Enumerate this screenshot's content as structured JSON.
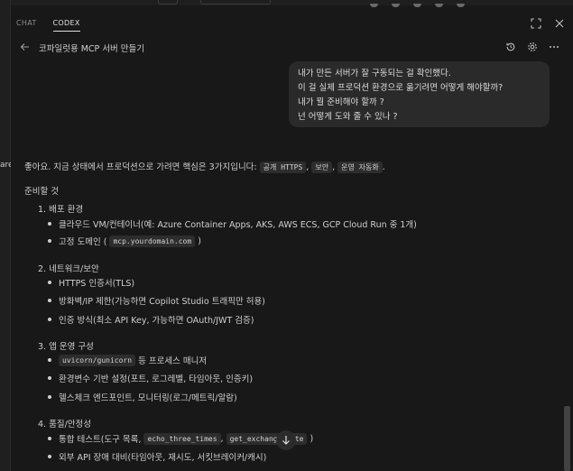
{
  "tabs": [
    {
      "label": "CHAT",
      "active": false
    },
    {
      "label": "CODEX",
      "active": true
    }
  ],
  "conversation": {
    "title": "코파일럿용 MCP 서버 만들기"
  },
  "left_edge_snippet": "are",
  "user_message": {
    "lines": [
      "내가 만든 서버가 잘 구동되는 걸 확인했다.",
      "이 걸 실제 프로덕션 환경으로 옮기려면 어떻게 해야할까?",
      "내가 뭘 준비해야 할까 ?",
      "넌 어떻게 도와 줄 수 있나 ?"
    ]
  },
  "answer": {
    "intro_text": "좋아요. 지금 상태에서 프로덕션으로 가려면 핵심은 3가지입니다:",
    "intro_codes": [
      "공개 HTTPS",
      "보안",
      "운영 자동화"
    ],
    "intro_sep": ",",
    "intro_end": ".",
    "prep_heading": "준비할 것",
    "sections": [
      {
        "title": "1. 배포 환경",
        "items": [
          {
            "text": "클라우드 VM/컨테이너(예: Azure Container Apps, AKS, AWS ECS, GCP Cloud Run 중 1개)"
          },
          {
            "pre": "고정 도메인 (",
            "code": "mcp.yourdomain.com",
            "post": ")"
          }
        ]
      },
      {
        "title": "2. 네트워크/보안",
        "items": [
          {
            "text": "HTTPS 인증서(TLS)"
          },
          {
            "text": "방화벽/IP 제한(가능하면 Copilot Studio 트래픽만 허용)"
          },
          {
            "text": "인증 방식(최소 API Key, 가능하면 OAuth/JWT 검증)"
          }
        ]
      },
      {
        "title": "3. 앱 운영 구성",
        "items": [
          {
            "code": "uvicorn/gunicorn",
            "post": "등 프로세스 매니저"
          },
          {
            "text": "환경변수 기반 설정(포트, 로그레벨, 타임아웃, 인증키)"
          },
          {
            "text": "헬스체크 엔드포인트, 모니터링(로그/메트릭/알람)"
          }
        ]
      },
      {
        "title": "4. 품질/안정성",
        "items": [
          {
            "pre": "통합 테스트(도구 목록,",
            "code": "echo_three_times",
            "sep": ",",
            "code2": "get_exchange_rate",
            "post": ")"
          },
          {
            "text": "외부 API 장애 대비(타임아웃, 재시도, 서킷브레이커/캐시)"
          }
        ]
      }
    ]
  },
  "icons": {
    "back": "arrow-left-icon",
    "history": "history-icon",
    "settings": "gear-icon",
    "close": "close-icon",
    "maximize": "maximize-icon",
    "more": "ellipsis-icon",
    "scroll_down": "arrow-down-icon"
  }
}
